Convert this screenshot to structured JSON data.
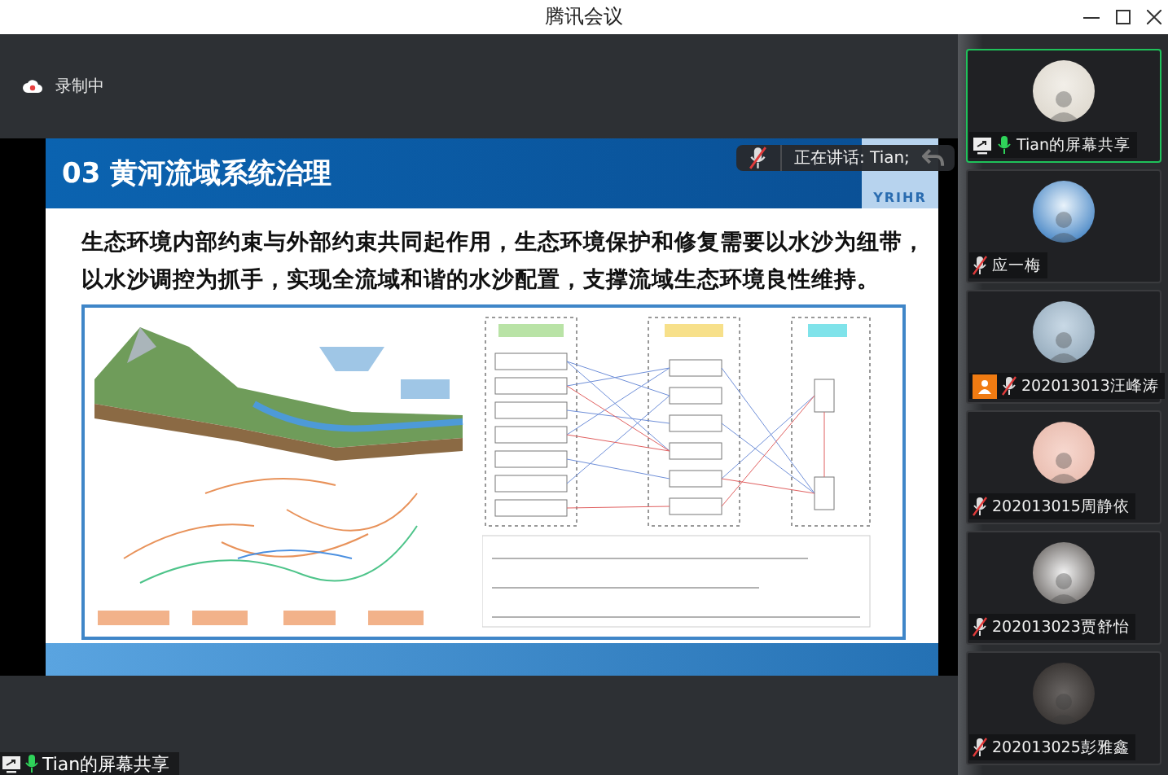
{
  "window": {
    "title": "腾讯会议"
  },
  "recording": {
    "label": "录制中"
  },
  "slide": {
    "title": "03 黄河流域系统治理",
    "logo_text": "YRIHR",
    "paragraph": [
      "生态环境内部约束与外部约束共同起作用，生态环境保护和修复需要以水沙为纽带，",
      "以水沙调控为抓手，实现全流域和谐的水沙配置，支撑流域生态环境良性维持。"
    ]
  },
  "speaking_toast": {
    "text": "正在讲话: Tian;",
    "muted": true
  },
  "participants": [
    {
      "name": "Tian的屏幕共享",
      "muted": false,
      "sharing": true,
      "host": false,
      "selected": true
    },
    {
      "name": "应一梅",
      "muted": true,
      "sharing": false,
      "host": false,
      "selected": false
    },
    {
      "name": "202013013汪峰涛",
      "muted": true,
      "sharing": false,
      "host": true,
      "selected": false
    },
    {
      "name": "202013015周静依",
      "muted": true,
      "sharing": false,
      "host": false,
      "selected": false
    },
    {
      "name": "202013023贾舒怡",
      "muted": true,
      "sharing": false,
      "host": false,
      "selected": false
    },
    {
      "name": "202013025彭雅鑫",
      "muted": true,
      "sharing": false,
      "host": false,
      "selected": false
    }
  ],
  "share_label": {
    "name": "Tian的屏幕共享",
    "muted": false
  }
}
